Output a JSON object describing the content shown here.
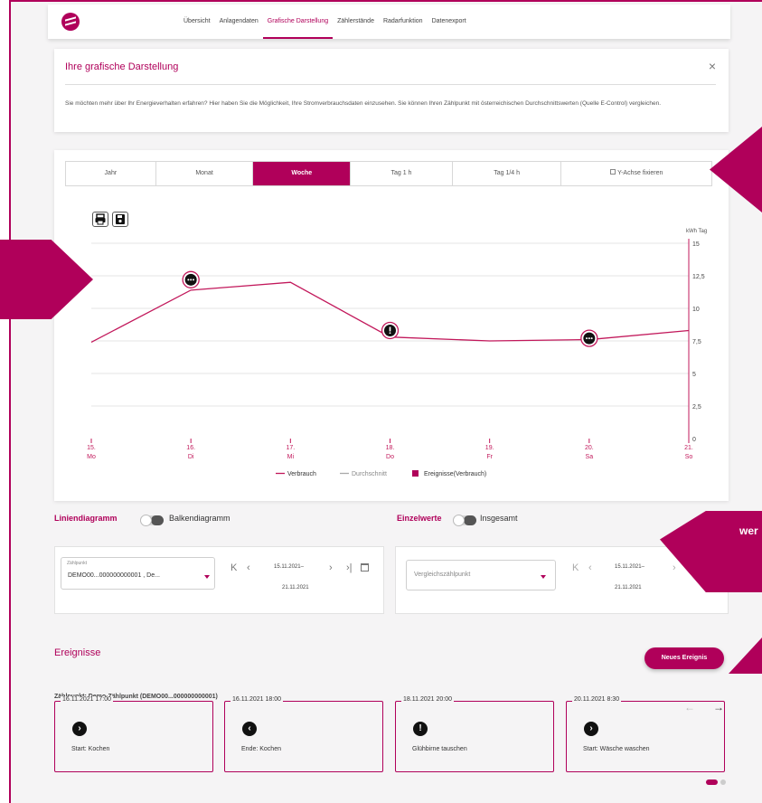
{
  "nav": {
    "items": [
      "Übersicht",
      "Anlagendaten",
      "Grafische Darstellung",
      "Zählerstände",
      "Radarfunktion",
      "Datenexport"
    ],
    "active_index": 2
  },
  "info": {
    "title": "Ihre grafische Darstellung",
    "close": "×",
    "text": "Sie möchten mehr über Ihr Energieverhalten erfahren? Hier haben Sie die Möglichkeit, Ihre Stromverbrauchsdaten einzusehen. Sie können Ihren Zählpunkt mit österreichischen Durchschnittswerten (Quelle E-Control) vergleichen."
  },
  "tabs": [
    {
      "label": "Jahr"
    },
    {
      "label": "Monat"
    },
    {
      "label": "Woche",
      "active": true
    },
    {
      "label": "Tag 1 h"
    },
    {
      "label": "Tag 1/4 h"
    },
    {
      "label": "Y-Achse fixieren",
      "checkbox": true
    }
  ],
  "chart_data": {
    "type": "line",
    "x": [
      "15. Mo",
      "16. Di",
      "17. Mi",
      "18. Do",
      "19. Fr",
      "20. Sa",
      "21. So"
    ],
    "x_top": [
      "15.",
      "16.",
      "17.",
      "18.",
      "19.",
      "20.",
      "21."
    ],
    "x_bottom": [
      "Mo",
      "Di",
      "Mi",
      "Do",
      "Fr",
      "Sa",
      "So"
    ],
    "series": [
      {
        "name": "Verbrauch",
        "values": [
          7.4,
          11.4,
          12.0,
          7.8,
          7.5,
          7.6,
          8.3
        ],
        "color": "#c2185b"
      }
    ],
    "events": [
      {
        "x_index": 1,
        "value": 12.2,
        "icon": "dots"
      },
      {
        "x_index": 3,
        "value": 8.3,
        "icon": "exclamation"
      },
      {
        "x_index": 5,
        "value": 7.7,
        "icon": "dots"
      }
    ],
    "yticks": [
      0,
      2.5,
      5,
      7.5,
      10,
      12.5,
      15
    ],
    "ytick_labels": [
      "0",
      "2,5",
      "5",
      "7,5",
      "10",
      "12,5",
      "15"
    ],
    "ylim": [
      0,
      15
    ],
    "ylabel": "kWh Tag",
    "legend": [
      "Verbrauch",
      "Durchschnitt",
      "Ereignisse(Verbrauch)"
    ],
    "legend_colors": [
      "#c2185b",
      "#aaaaaa",
      "#b0005a"
    ],
    "legend_position": "bottom",
    "grid": true
  },
  "toggles": {
    "left_on": "Liniendiagramm",
    "left_off": "Balkendiagramm",
    "right_on": "Einzelwerte",
    "right_off": "Insgesamt"
  },
  "selector_left": {
    "small_label": "Zählpunkt",
    "value": "DEMO00...000000000001 , De...",
    "date_line1": "15.11.2021–",
    "date_line2": "21.11.2021"
  },
  "selector_right": {
    "placeholder": "Vergleichszählpunkt",
    "date_line1": "15.11.2021–",
    "date_line2": "21.11.2021"
  },
  "events_section": {
    "title": "Ereignisse",
    "new_button": "Neues Ereignis",
    "zp_label": "Zählpunkt: Demo-Zählpunkt (DEMO00...000000000001)",
    "cards": [
      {
        "date": "16.11.2021 17:00",
        "icon": "›",
        "text": "Start: Kochen"
      },
      {
        "date": "16.11.2021 18:00",
        "icon": "‹",
        "text": "Ende: Kochen"
      },
      {
        "date": "18.11.2021 20:00",
        "icon": "!",
        "text": "Glühbirne tauschen"
      },
      {
        "date": "20.11.2021 8:30",
        "icon": "›",
        "text": "Start: Wäsche waschen"
      }
    ]
  },
  "deco": {
    "right_label": "wer"
  },
  "colors": {
    "accent": "#b0005a",
    "page_bg": "#f5f4f5"
  }
}
